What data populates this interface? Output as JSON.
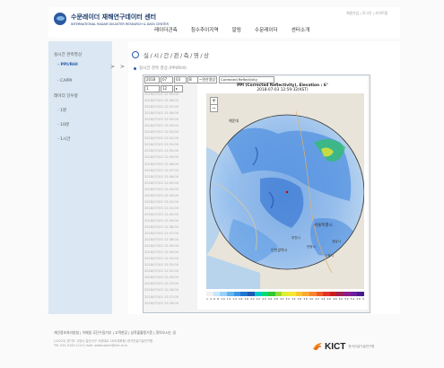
{
  "header": {
    "logo_title": "수문레이더 재해연구데이터 센터",
    "logo_subtitle": "INTERNATIONAL RADAR DISASTER RESEARCH & DATA CENTER",
    "util_links": "회원가입 | 로그인 | 사이트맵",
    "nav": [
      "레이더관측",
      "침수추이지역",
      "알림",
      "수문레이더",
      "센터소개"
    ]
  },
  "sidebar": {
    "items": [
      {
        "label": "실시간 관측영상",
        "active": false
      },
      {
        "label": "- PPI/RHI",
        "active": true
      },
      {
        "label": "- CAPPI",
        "active": false
      },
      {
        "label": "레이더 강우량",
        "active": false
      },
      {
        "label": "- 1분",
        "active": false
      },
      {
        "label": "- 10분",
        "active": false
      },
      {
        "label": "- 1시간",
        "active": false
      }
    ],
    "arrow": "> >"
  },
  "main": {
    "title": "실/시/간/관/측/영/상",
    "subtitle": "실시간 관측 영상 (PPI/RHI)",
    "controls": {
      "year": "2018",
      "month": "07",
      "day": "03",
      "station": "B",
      "hour": "1",
      "minute": "12",
      "product_label": "~연산영상",
      "product": "Corrected Reflectivity"
    },
    "times": [
      "2018/07/03 12:59:00",
      "2018/07/03 12:58:00",
      "2018/07/03 12:57:00",
      "2018/07/03 12:56:00",
      "2018/07/03 12:55:00",
      "2018/07/03 12:54:00",
      "2018/07/03 12:53:00",
      "2018/07/03 12:52:00",
      "2018/07/03 12:51:00",
      "2018/07/03 12:50:00",
      "2018/07/03 12:49:00",
      "2018/07/03 12:48:00",
      "2018/07/03 12:47:00",
      "2018/07/03 12:46:00",
      "2018/07/03 12:45:00",
      "2018/07/03 12:44:00",
      "2018/07/03 12:43:00",
      "2018/07/03 12:42:00",
      "2018/07/03 12:41:00",
      "2018/07/03 12:40:00",
      "2018/07/03 12:39:00",
      "2018/07/03 12:38:00",
      "2018/07/03 12:37:00",
      "2018/07/03 12:36:00",
      "2018/07/03 12:35:00",
      "2018/07/03 12:34:00",
      "2018/07/03 12:33:00",
      "2018/07/03 12:32:00",
      "2018/07/03 12:31:00",
      "2018/07/03 12:30:00",
      "2018/07/03 12:29:00",
      "2018/07/03 12:28:00",
      "2018/07/03 12:27:00",
      "2018/07/03 12:26:00"
    ],
    "map_title_1": "PPI (Corrected Reflectivity), Elevation : 6°",
    "map_title_2": "2018-07-03 12:59:32(KST)",
    "map_labels": [
      "해운대",
      "서울특별시",
      "인천광역시",
      "부천시",
      "수원시",
      "성남시",
      "안양시"
    ],
    "zoom_in": "+",
    "zoom_out": "−",
    "colorbar_labels": "1  4  6  8  10 12 14 16 18 20 22 24 26 28 30 32 34 36 38 40 42 44 46 48 50 52 54 56 58 60 62 dBZ",
    "colorbar_colors": [
      "#f0f0f0",
      "#c8e6fa",
      "#96d2fa",
      "#64b4f0",
      "#3c96e6",
      "#1e78d2",
      "#1e5ab4",
      "#00c8c8",
      "#00dc78",
      "#32c832",
      "#96dc32",
      "#dcf032",
      "#fae632",
      "#fac832",
      "#faaa32",
      "#fa8232",
      "#f05a28",
      "#e63228",
      "#c81e1e",
      "#a01e50",
      "#8c1e8c",
      "#6e1ea0",
      "#461e8c"
    ]
  },
  "footer": {
    "links": "개인정보처리방침 | 이메일 무단수집거부 | 고객헌장 | 상작물활용기준 | 찾아오시는 길",
    "address_1": "(10223) 경기도 고양시 일산서구 고양대로 283(대화동) 한국건설기술연구원",
    "address_2": "TEL 031-9100-114  E-mail: webmaster@kict.re.kr",
    "logo_text": "KICT",
    "logo_sub": "한국건설기술연구원"
  }
}
